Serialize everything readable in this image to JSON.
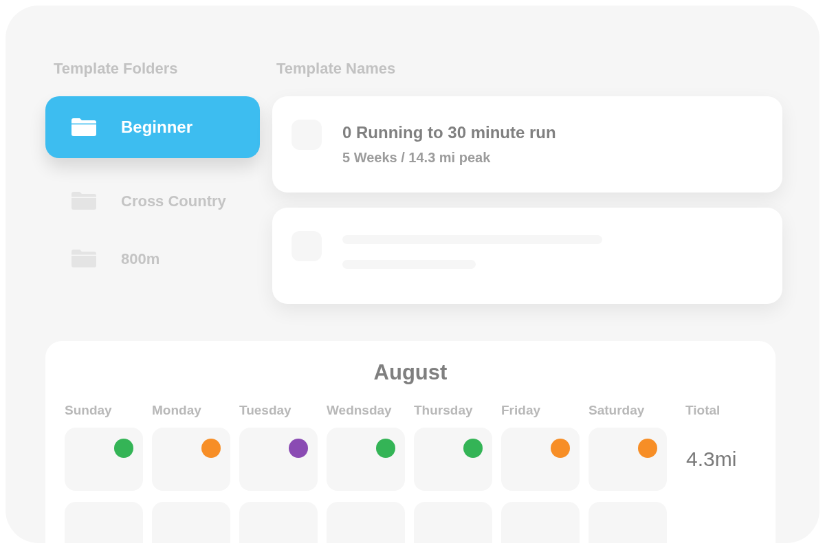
{
  "folders": {
    "heading": "Template Folders",
    "items": [
      {
        "name": "Beginner",
        "selected": true
      },
      {
        "name": "Cross Country",
        "selected": false
      },
      {
        "name": "800m",
        "selected": false
      }
    ]
  },
  "templates": {
    "heading": "Template Names",
    "items": [
      {
        "kind": "template",
        "title": "0 Running to 30 minute run",
        "subtitle": "5 Weeks / 14.3 mi peak"
      },
      {
        "kind": "skeleton"
      }
    ]
  },
  "calendar": {
    "month": "August",
    "weekdays": [
      "Sunday",
      "Monday",
      "Tuesday",
      "Wednsday",
      "Thursday",
      "Friday",
      "Saturday"
    ],
    "total_heading": "Tiotal",
    "weeks": [
      {
        "days": [
          {
            "kind": "run",
            "color": "#34b456"
          },
          {
            "kind": "run",
            "color": "#f78e26"
          },
          {
            "kind": "run",
            "color": "#8a4bb3"
          },
          {
            "kind": "run",
            "color": "#34b456"
          },
          {
            "kind": "run",
            "color": "#34b456"
          },
          {
            "kind": "run",
            "color": "#f78e26"
          },
          {
            "kind": "run",
            "color": "#f78e26"
          }
        ],
        "total": "4.3mi"
      },
      {
        "days": [
          {
            "kind": "blank"
          },
          {
            "kind": "blank"
          },
          {
            "kind": "blank"
          },
          {
            "kind": "blank"
          },
          {
            "kind": "blank"
          },
          {
            "kind": "blank"
          },
          {
            "kind": "blank"
          }
        ]
      }
    ]
  }
}
